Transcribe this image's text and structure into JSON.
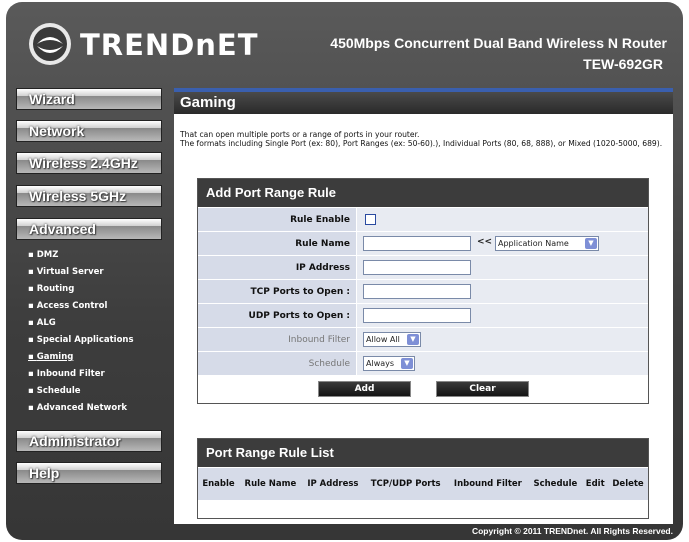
{
  "header": {
    "brand": "TRENDnET",
    "model_line": "450Mbps Concurrent Dual Band Wireless N Router",
    "model_code": "TEW-692GR"
  },
  "nav": {
    "wizard": "Wizard",
    "network": "Network",
    "wireless24": "Wireless 2.4GHz",
    "wireless5": "Wireless 5GHz",
    "advanced": "Advanced",
    "administrator": "Administrator",
    "help": "Help",
    "sub_items": [
      "DMZ",
      "Virtual Server",
      "Routing",
      "Access Control",
      "ALG",
      "Special Applications",
      "Gaming",
      "Inbound Filter",
      "Schedule",
      "Advanced Network"
    ]
  },
  "page": {
    "title": "Gaming",
    "desc_1": "That can open multiple ports or a range of ports in your router.",
    "desc_2": "The formats including Single Port (ex: 80), Port Ranges (ex: 50-60).), Individual Ports (80, 68, 888), or Mixed (1020-5000, 689)."
  },
  "add_rule": {
    "heading": "Add Port Range Rule",
    "rule_enable_label": "Rule Enable",
    "rule_name_label": "Rule Name",
    "rule_name_value": "",
    "arrows": "<<",
    "app_name_select": "Application Name",
    "ip_address_label": "IP Address",
    "ip_address_value": "",
    "tcp_label": "TCP Ports to Open :",
    "tcp_value": "",
    "udp_label": "UDP Ports to Open :",
    "udp_value": "",
    "inbound_filter_label": "Inbound Filter",
    "inbound_filter_value": "Allow All",
    "schedule_label": "Schedule",
    "schedule_value": "Always",
    "add_button": "Add",
    "clear_button": "Clear"
  },
  "rule_list": {
    "heading": "Port Range Rule List",
    "columns": [
      "Enable",
      "Rule Name",
      "IP Address",
      "TCP/UDP Ports",
      "Inbound Filter",
      "Schedule",
      "Edit",
      "Delete"
    ]
  },
  "footer": {
    "copyright": "Copyright © 2011 TRENDnet. All Rights Reserved."
  },
  "colors": {
    "accent_blue": "#3a5fae",
    "label_bg": "#d6dbe8"
  }
}
